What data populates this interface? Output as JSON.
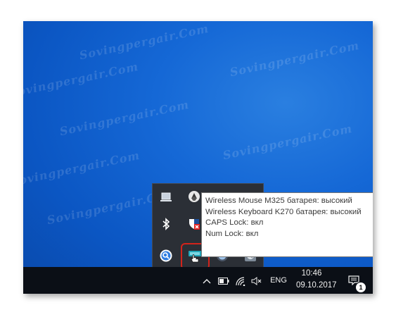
{
  "watermark": "Sovingpergair.Com",
  "tooltip": {
    "line1": "Wireless Mouse M325 батарея: высокий",
    "line2": "Wireless Keyboard K270 батарея: высокий",
    "line3": "CAPS Lock: вкл",
    "line4": "Num Lock: вкл"
  },
  "tray_icons": [
    "laptop-icon",
    "mouse-device-icon",
    "monitor-icon",
    "bluetooth-icon",
    "windows-defender-icon",
    "magnifier-app-icon",
    "logitech-unifying-icon",
    "globe-app-icon",
    "security-app-icon"
  ],
  "taskbar": {
    "language": "ENG",
    "time": "10:46",
    "date": "09.10.2017",
    "notification_count": "1"
  },
  "colors": {
    "desktop": "#1568d6",
    "taskbar": "#0b0f16",
    "popup": "#2b2f36",
    "highlight": "#d3231b"
  }
}
